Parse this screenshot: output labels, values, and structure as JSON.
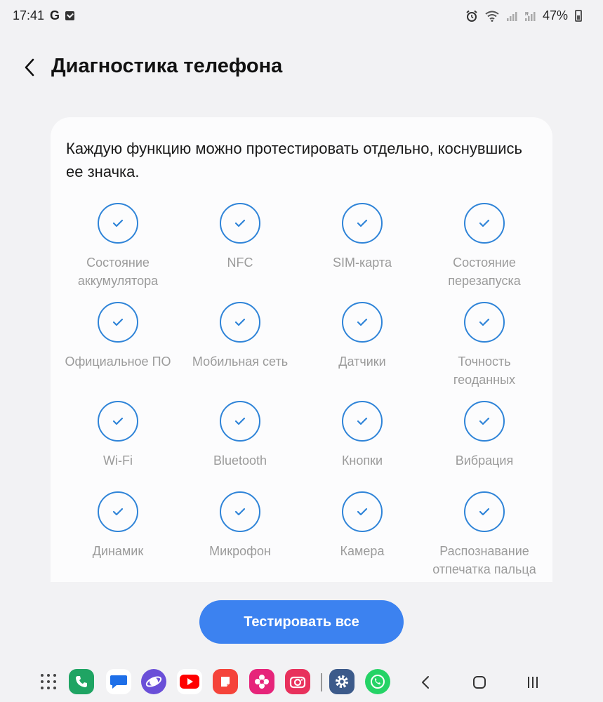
{
  "status_bar": {
    "time": "17:41",
    "left_icons": [
      "google-icon",
      "checkbox-notification-icon"
    ],
    "right_icons": [
      "alarm-icon",
      "wifi-icon",
      "signal-icon",
      "roaming-signal-icon"
    ],
    "battery": "47%"
  },
  "header": {
    "title": "Диагностика телефона",
    "back_icon": "chevron-left-icon"
  },
  "card": {
    "description": "Каждую функцию можно протестировать отдельно, коснувшись ее значка.",
    "items": [
      {
        "label": "Состояние\nаккумулятора"
      },
      {
        "label": "NFC"
      },
      {
        "label": "SIM-карта"
      },
      {
        "label": "Состояние\nперезапуска"
      },
      {
        "label": "Официальное ПО"
      },
      {
        "label": "Мобильная сеть"
      },
      {
        "label": "Датчики"
      },
      {
        "label": "Точность\nгеоданных"
      },
      {
        "label": "Wi-Fi"
      },
      {
        "label": "Bluetooth"
      },
      {
        "label": "Кнопки"
      },
      {
        "label": "Вибрация"
      },
      {
        "label": "Динамик"
      },
      {
        "label": "Микрофон"
      },
      {
        "label": "Камера"
      },
      {
        "label": "Распознавание\nотпечатка пальца"
      }
    ]
  },
  "test_all_button": {
    "label": "Тестировать все"
  },
  "colors": {
    "accent": "#3c82f0",
    "check": "#2f84d8",
    "background": "#f2f2f4",
    "card": "#fcfcfd",
    "label_gray": "#9b9b9b"
  },
  "taskbar": {
    "apps": [
      {
        "name": "phone-app-icon",
        "color": "#1fa463"
      },
      {
        "name": "messages-app-icon",
        "color": "#1e6fe8"
      },
      {
        "name": "internet-app-icon",
        "color": "#6a4fd8"
      },
      {
        "name": "youtube-app-icon",
        "color": "#ff0000"
      },
      {
        "name": "notes-app-icon",
        "color": "#f5433a"
      },
      {
        "name": "gallery-app-icon",
        "color": "#e6247a"
      },
      {
        "name": "camera-app-icon",
        "color": "#e8315c"
      },
      {
        "name": "settings-app-icon",
        "color": "#3c5a8a"
      },
      {
        "name": "whatsapp-app-icon",
        "color": "#25d366"
      }
    ],
    "nav": [
      "back-nav-icon",
      "home-nav-icon",
      "recents-nav-icon"
    ]
  }
}
